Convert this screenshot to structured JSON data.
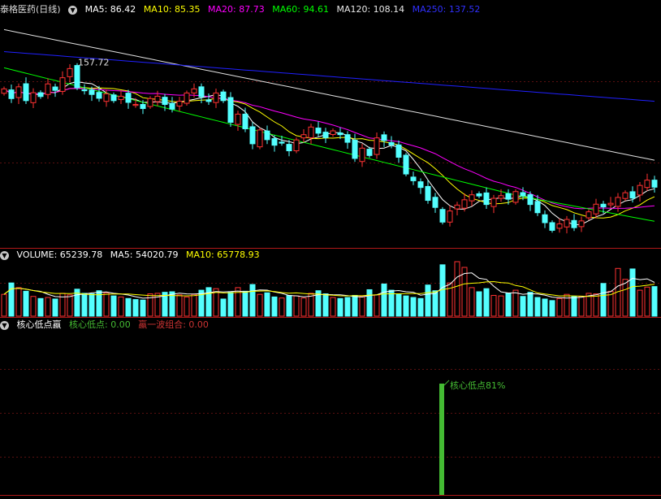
{
  "main": {
    "stock_name": "泰格医药(日线)",
    "ma_labels": [
      {
        "text": "MA5: 86.42",
        "color": "#ffffff"
      },
      {
        "text": "MA10: 85.35",
        "color": "#ffff00"
      },
      {
        "text": "MA20: 87.73",
        "color": "#ff00ff"
      },
      {
        "text": "MA60: 94.61",
        "color": "#00ff00"
      },
      {
        "text": "MA120: 108.14",
        "color": "#e8e8e8"
      },
      {
        "text": "MA250: 137.52",
        "color": "#3030ff"
      }
    ],
    "high_label": "157.72"
  },
  "volume": {
    "title": "VOLUME: 65239.78",
    "ma5": "MA5: 54020.79",
    "ma10": "MA10: 65778.93"
  },
  "indicator": {
    "title": "核心低点蠃",
    "label1": "核心低点: 0.00",
    "label2": "蠃一波组合: 0.00",
    "annotation": "核心低点81%",
    "bar_color": "#44bb33"
  },
  "chart_data": {
    "type": "candlestick",
    "series_close": [
      150.8,
      147.5,
      151.5,
      146.8,
      149.5,
      148.2,
      152.5,
      150.3,
      154.6,
      157.72,
      151.2,
      150.4,
      148.9,
      147.6,
      149.1,
      146.8,
      148.3,
      146.2,
      145.5,
      144.1,
      147.5,
      148.3,
      145.5,
      143.9,
      146.6,
      149.4,
      150.8,
      148.1,
      146.5,
      149.4,
      146.8,
      139.4,
      142.2,
      137.2,
      132.1,
      136.8,
      133.5,
      131.6,
      132.6,
      129.7,
      133.4,
      135.2,
      137.8,
      135.7,
      134.2,
      136.5,
      135.2,
      132.6,
      127.1,
      130.6,
      128.1,
      134.1,
      133.2,
      131.7,
      127.5,
      121.8,
      119.5,
      117.2,
      112.8,
      110.4,
      105.4,
      109.2,
      111.2,
      113.0,
      114.7,
      114.3,
      111.4,
      113.5,
      114.4,
      113.2,
      115.8,
      114.4,
      111.4,
      108.6,
      105.2,
      102.6,
      104.8,
      106.3,
      103.5,
      105.8,
      108.9,
      111.5,
      110.6,
      111.8,
      113.8,
      115.4,
      113.6,
      117.9,
      119.7,
      117.3
    ],
    "volume": [
      42,
      64,
      55,
      48,
      38,
      34,
      36,
      33,
      44,
      41,
      52,
      44,
      43,
      49,
      45,
      39,
      37,
      34,
      32,
      31,
      43,
      44,
      46,
      47,
      41,
      37,
      42,
      50,
      55,
      53,
      33,
      46,
      55,
      48,
      61,
      42,
      45,
      37,
      35,
      40,
      39,
      35,
      44,
      49,
      43,
      36,
      34,
      36,
      40,
      38,
      51,
      41,
      62,
      50,
      43,
      39,
      36,
      34,
      60,
      49,
      99,
      64,
      105,
      94,
      55,
      47,
      53,
      40,
      39,
      44,
      50,
      38,
      46,
      36,
      33,
      30,
      34,
      42,
      38,
      38,
      44,
      43,
      63,
      48,
      92,
      71,
      91,
      50,
      56,
      57
    ]
  }
}
